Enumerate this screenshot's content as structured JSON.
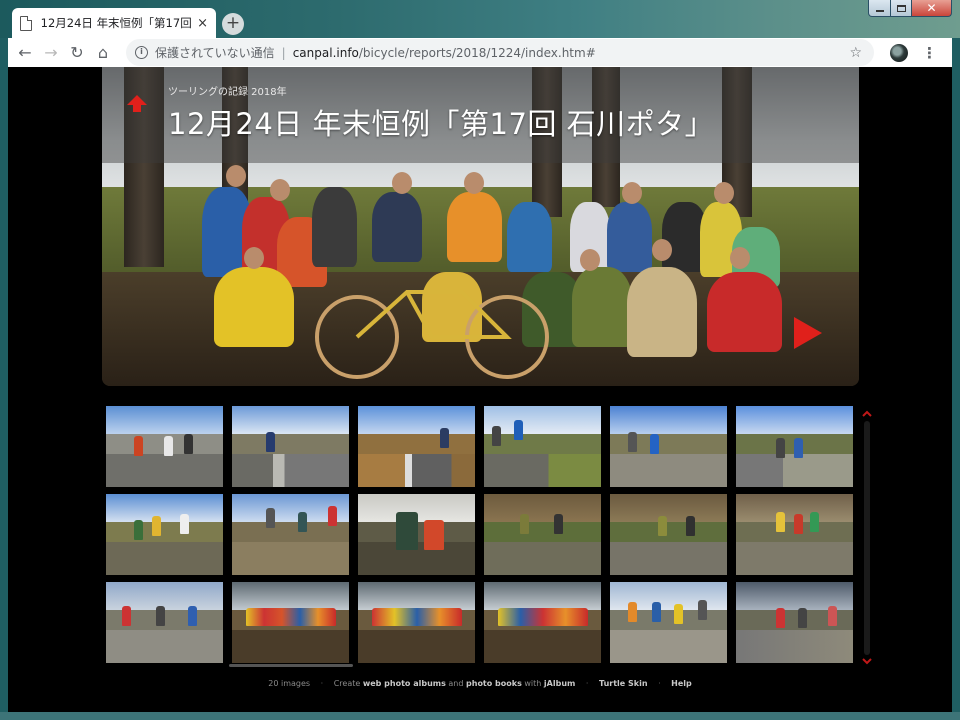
{
  "browser": {
    "tab_title": "12月24日 年末恒例「第17回 石",
    "tab_close": "×",
    "new_tab": "+",
    "win_close": "✕",
    "nav_back": "←",
    "nav_forward": "→",
    "nav_reload": "↻",
    "nav_home": "⌂",
    "security_label": "保護されていない通信",
    "url_separator": "|",
    "url_host": "canpal.info",
    "url_path": "/bicycle/reports/2018/1224/index.htm#",
    "star": "☆",
    "menu": "⋮"
  },
  "hero": {
    "category": "ツーリングの記録 2018年",
    "title": "12月24日 年末恒例「第17回 石川ポタ」",
    "colors": {
      "accent_red": "#e0201b",
      "band": "rgba(60,60,60,0.45)"
    }
  },
  "thumbnails": {
    "count_rows": 3,
    "count_cols": 6
  },
  "footer": {
    "count": "20 images",
    "create_prefix": "Create",
    "link_albums": "web photo albums",
    "and": "and",
    "link_books": "photo books",
    "with": "with",
    "link_jalbum": "jAlbum",
    "link_skin": "Turtle Skin",
    "link_help": "Help",
    "separator": "·"
  }
}
